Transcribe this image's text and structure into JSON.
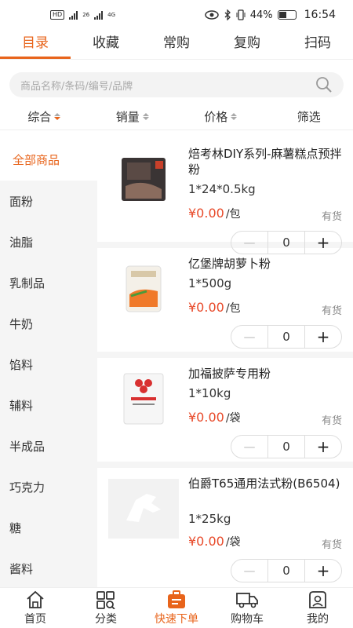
{
  "status_bar": {
    "left_badges": [
      "HD",
      "26",
      "4G"
    ],
    "battery": "44%",
    "time": "16:54"
  },
  "top_tabs": [
    {
      "label": "目录",
      "active": true
    },
    {
      "label": "收藏",
      "active": false
    },
    {
      "label": "常购",
      "active": false
    },
    {
      "label": "复购",
      "active": false
    },
    {
      "label": "扫码",
      "active": false
    }
  ],
  "search": {
    "placeholder": "商品名称/条码/编号/品牌"
  },
  "sort": {
    "comprehensive": "综合",
    "sales": "销量",
    "price": "价格",
    "filter": "筛选"
  },
  "categories": [
    {
      "label": "全部商品",
      "active": true
    },
    {
      "label": "面粉"
    },
    {
      "label": "油脂"
    },
    {
      "label": "乳制品"
    },
    {
      "label": "牛奶"
    },
    {
      "label": "馅料"
    },
    {
      "label": "辅料"
    },
    {
      "label": "半成品"
    },
    {
      "label": "巧克力"
    },
    {
      "label": "糖"
    },
    {
      "label": "酱料"
    }
  ],
  "products": [
    {
      "name": "焙考林DIY系列-麻薯糕点预拌粉",
      "spec": "1*24*0.5kg",
      "price": "¥0.00",
      "unit": "/包",
      "stock": "有货",
      "qty": "0",
      "img": "dark-bag"
    },
    {
      "name": "亿堡牌胡萝卜粉",
      "spec": "1*500g",
      "price": "¥0.00",
      "unit": "/包",
      "stock": "有货",
      "qty": "0",
      "img": "white-bag-orange"
    },
    {
      "name": "加福披萨专用粉",
      "spec": "1*10kg",
      "price": "¥0.00",
      "unit": "/袋",
      "stock": "有货",
      "qty": "0",
      "img": "white-sack-red"
    },
    {
      "name": "伯爵T65通用法式粉(B6504)",
      "spec": "1*25kg",
      "price": "¥0.00",
      "unit": "/袋",
      "stock": "有货",
      "qty": "0",
      "img": "placeholder-horse"
    }
  ],
  "stepper": {
    "minus": "—",
    "plus": "+"
  },
  "bottom_nav": [
    {
      "label": "首页",
      "icon": "home-icon"
    },
    {
      "label": "分类",
      "icon": "category-icon"
    },
    {
      "label": "快速下单",
      "icon": "quick-order-icon",
      "active": true
    },
    {
      "label": "购物车",
      "icon": "cart-truck-icon"
    },
    {
      "label": "我的",
      "icon": "profile-icon"
    }
  ],
  "colors": {
    "accent": "#e8641b",
    "price": "#e84a2a"
  }
}
